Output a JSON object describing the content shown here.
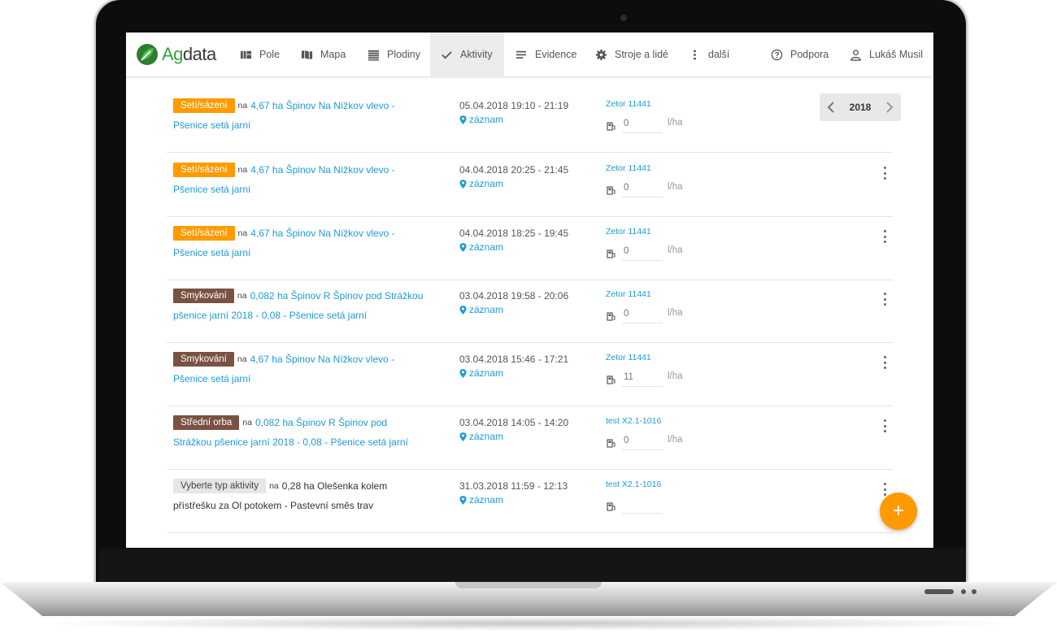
{
  "brand": {
    "logo_prefix": "Ag",
    "logo_suffix": "data"
  },
  "nav": {
    "items": [
      {
        "label": "Pole",
        "icon": "fields-icon"
      },
      {
        "label": "Mapa",
        "icon": "map-icon"
      },
      {
        "label": "Plodiny",
        "icon": "crops-icon"
      },
      {
        "label": "Aktivity",
        "icon": "check-icon",
        "active": true
      },
      {
        "label": "Evidence",
        "icon": "list-icon"
      },
      {
        "label": "Stroje a lidé",
        "icon": "gear-icon"
      },
      {
        "label": "další",
        "icon": "more-vertical-icon"
      },
      {
        "label": "Podpora",
        "icon": "help-icon"
      },
      {
        "label": "Lukáš Musil",
        "icon": "user-icon"
      }
    ]
  },
  "year_selector": {
    "year": "2018"
  },
  "common": {
    "na": "na",
    "zaznam": "záznam",
    "unit": "l/ha"
  },
  "rows": [
    {
      "type": "Setí/sázení",
      "color": "orange",
      "field_line1": "4,67 ha Špinov Na Nížkov vlevo -",
      "field_line2": "Pšenice setá jarní",
      "datetime": "05.04.2018 19:10 - 21:19",
      "machine": "Zetor 11441",
      "fuel": "0",
      "menu": false
    },
    {
      "type": "Setí/sázení",
      "color": "orange",
      "field_line1": "4,67 ha Špinov Na Nížkov vlevo -",
      "field_line2": "Pšenice setá jarní",
      "datetime": "04.04.2018 20:25 - 21:45",
      "machine": "Zetor 11441",
      "fuel": "0",
      "menu": true
    },
    {
      "type": "Setí/sázení",
      "color": "orange",
      "field_line1": "4,67 ha Špinov Na Nížkov vlevo -",
      "field_line2": "Pšenice setá jarní",
      "datetime": "04.04.2018 18:25 - 19:45",
      "machine": "Zetor 11441",
      "fuel": "0",
      "menu": true
    },
    {
      "type": "Smykování",
      "color": "brown",
      "field_line1": "0,082 ha Špinov R Špinov pod Strážkou",
      "field_line2": "pšenice jarní 2018 - 0,08 - Pšenice setá jarní",
      "datetime": "03.04.2018 19:58 - 20:06",
      "machine": "Zetor 11441",
      "fuel": "0",
      "menu": true
    },
    {
      "type": "Smykování",
      "color": "brown",
      "field_line1": "4,67 ha Špinov Na Nížkov vlevo -",
      "field_line2": "Pšenice setá jarní",
      "datetime": "03.04.2018 15:46 - 17:21",
      "machine": "Zetor 11441",
      "fuel": "11",
      "menu": true
    },
    {
      "type": "Střední orba",
      "color": "brown",
      "field_line1": "0,082 ha Špinov R Špinov pod",
      "field_line2": "Strážkou pšenice jarní 2018 - 0,08 - Pšenice setá jarní",
      "datetime": "03.04.2018 14:05 - 14:20",
      "machine": "test X2.1-1016",
      "fuel": "0",
      "menu": true
    },
    {
      "type": "Vyberte typ aktivity",
      "color": "grey",
      "field_line1": "0,28 ha Olešenka kolem",
      "field_line2": "přístřešku za Ol potokem - Pastevní směs trav",
      "datetime": "31.03.2018 11:59 - 12:13",
      "machine": "test X2.1-1016",
      "fuel": "",
      "menu": true
    }
  ],
  "fab": {
    "label": "+"
  }
}
